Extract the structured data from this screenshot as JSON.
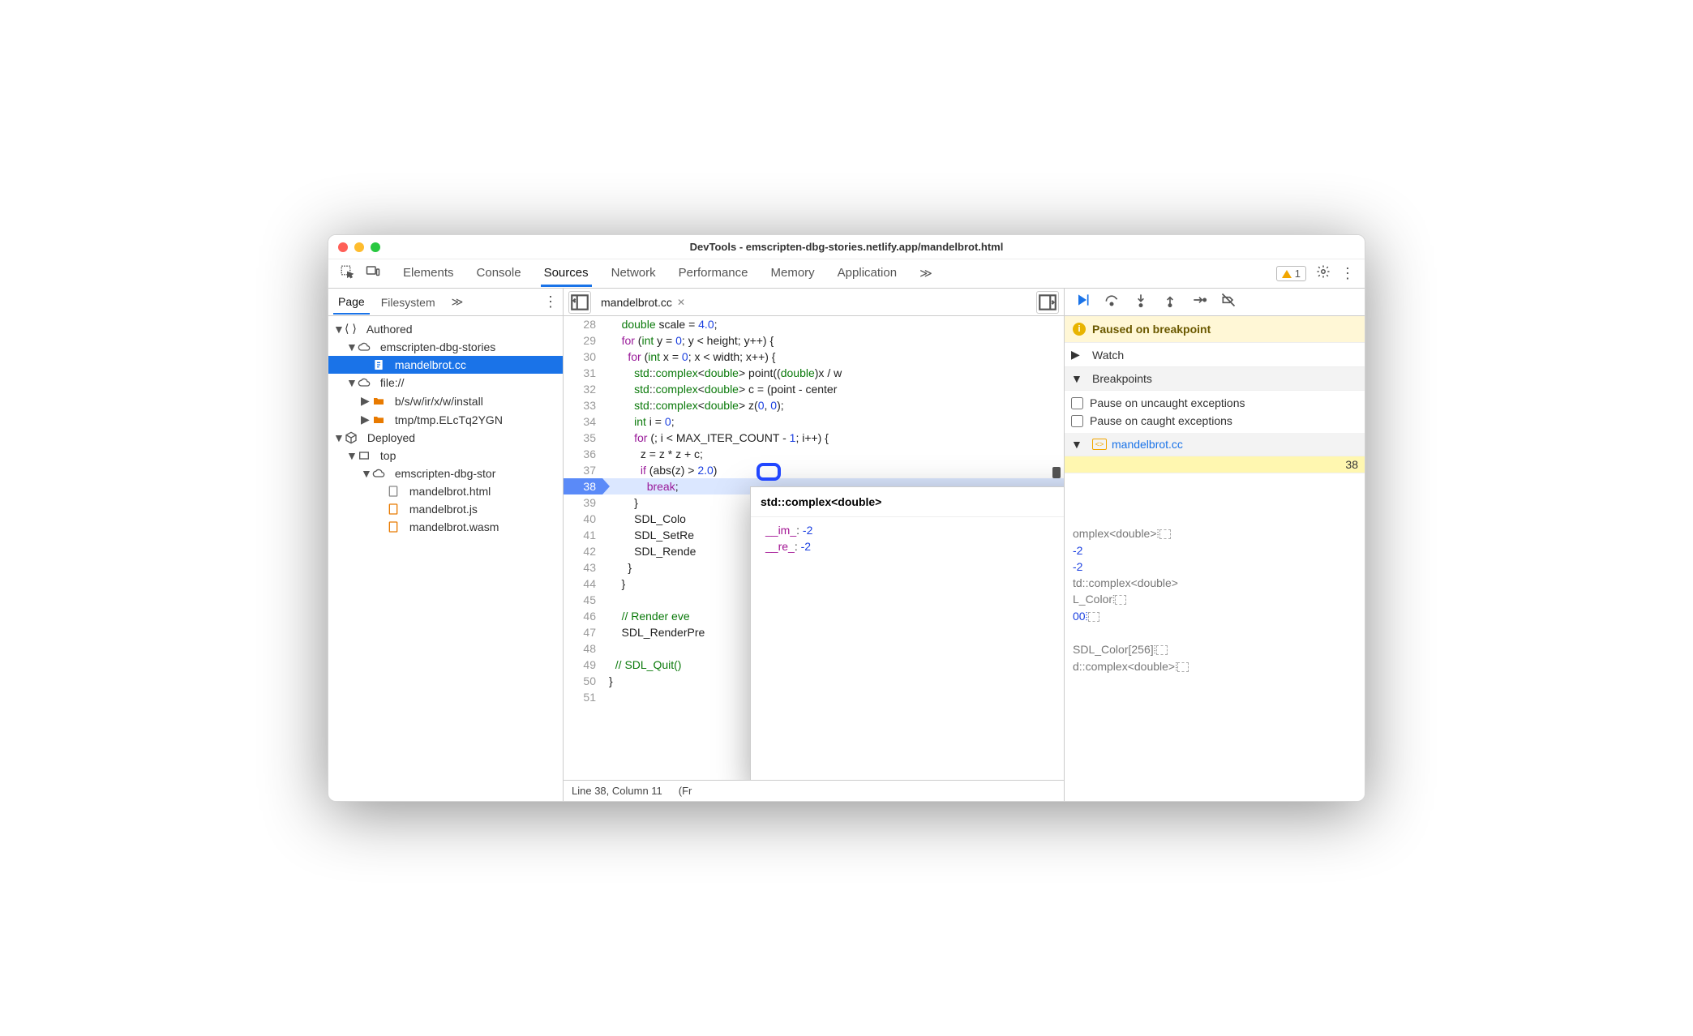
{
  "titlebar": {
    "title": "DevTools - emscripten-dbg-stories.netlify.app/mandelbrot.html"
  },
  "tabs": {
    "items": [
      "Elements",
      "Console",
      "Sources",
      "Network",
      "Performance",
      "Memory",
      "Application"
    ],
    "active": 2,
    "overflow": "≫",
    "warn_count": "1"
  },
  "left": {
    "tabs": {
      "page": "Page",
      "filesystem": "Filesystem",
      "more": "≫"
    },
    "tree": {
      "authored": "Authored",
      "site": "emscripten-dbg-stories",
      "file_sel": "mandelbrot.cc",
      "file_scheme": "file://",
      "folder1": "b/s/w/ir/x/w/install",
      "folder2": "tmp/tmp.ELcTq2YGN",
      "deployed": "Deployed",
      "top": "top",
      "site2": "emscripten-dbg-stor",
      "html": "mandelbrot.html",
      "js": "mandelbrot.js",
      "wasm": "mandelbrot.wasm"
    }
  },
  "editor": {
    "tab": "mandelbrot.cc",
    "lines": {
      "28": "    double scale = 4.0;",
      "29": "    for (int y = 0; y < height; y++) {",
      "30": "      for (int x = 0; x < width; x++) {",
      "31": "        std::complex<double> point((double)x / w",
      "32": "        std::complex<double> c = (point - center",
      "33": "        std::complex<double> z(0, 0);",
      "34": "        int i = 0;",
      "35": "        for (; i < MAX_ITER_COUNT - 1; i++) {",
      "36": "          z = z * z + c;",
      "37": "          if (abs(z) > 2.0)",
      "38": "            break;",
      "39": "        }",
      "40": "        SDL_Colo",
      "41": "        SDL_SetRe",
      "42": "        SDL_Rende",
      "43": "      }",
      "44": "    }",
      "45": "",
      "46": "    // Render eve",
      "47": "    SDL_RenderPre",
      "48": "",
      "49": "  // SDL_Quit()",
      "50": "}",
      "51": ""
    },
    "status_left": "Line 38, Column 11",
    "status_right": "(Fr"
  },
  "right": {
    "paused": "Paused on breakpoint",
    "watch": "Watch",
    "breakpoints": "Breakpoints",
    "pause_uncaught": "Pause on uncaught exceptions",
    "pause_caught": "Pause on caught exceptions",
    "bp_file": "mandelbrot.cc",
    "bp_line": "38",
    "scope": [
      "omplex<double>⦙",
      "-2",
      "-2",
      "td::complex<double>",
      "L_Color⦙",
      "00⦙",
      "",
      "SDL_Color[256]⦙",
      "d::complex<double>⦙"
    ]
  },
  "popup": {
    "title": "std::complex<double>",
    "kv": [
      {
        "k": "__im_",
        "v": "-2"
      },
      {
        "k": "__re_",
        "v": "-2"
      }
    ]
  }
}
